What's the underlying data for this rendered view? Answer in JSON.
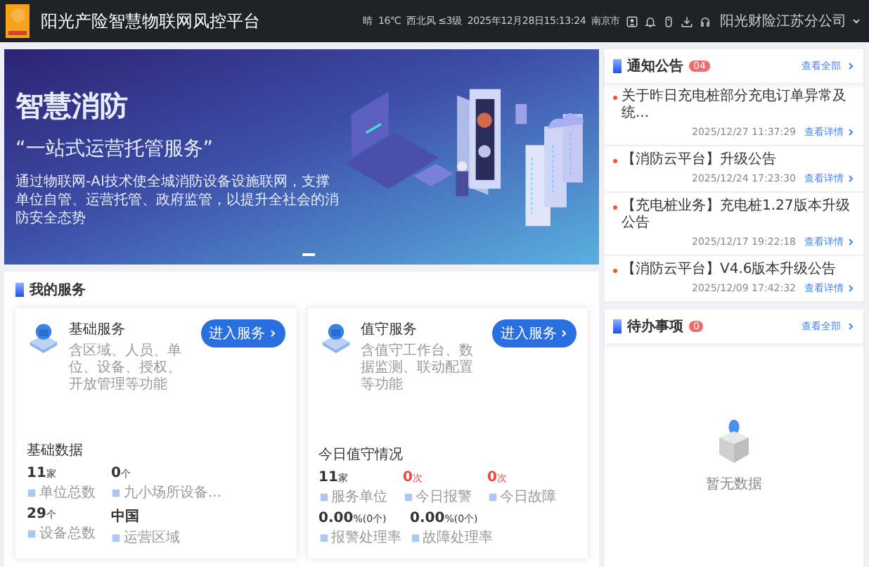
{
  "header": {
    "title": "阳光产险智慧物联网风控平台",
    "weather": "晴",
    "temperature": "16℃",
    "wind": "西北风 ≤3级",
    "datetime": "2025年12月28日15:13:24",
    "city": "南京市",
    "company": "阳光财险江苏分公司"
  },
  "banner": {
    "title": "智慧消防",
    "slogan": "“一站式运营托管服务”",
    "description": "通过物联网-AI技术使全城消防设备设施联网，支撑单位自管、运营托管、政府监管，以提升全社会的消防安全态势"
  },
  "services": {
    "title": "我的服务",
    "cards": [
      {
        "name": "基础服务",
        "description": "含区域、人员、单位、设备、授权、开放管理等功能",
        "button": "进入服务",
        "stats_title": "基础数据",
        "stats": [
          {
            "value": "11",
            "unit": "家",
            "label": "单位总数",
            "alert": false
          },
          {
            "value": "0",
            "unit": "个",
            "label": "九小场所设备...",
            "alert": false
          },
          {
            "value": "29",
            "unit": "个",
            "label": "设备总数",
            "alert": false
          },
          {
            "value": "中国",
            "label": "运营区域",
            "alert": false
          }
        ]
      },
      {
        "name": "值守服务",
        "description": "含值守工作台、数据监测、联动配置等功能",
        "button": "进入服务",
        "stats_title": "今日值守情况",
        "stats": [
          {
            "value": "11",
            "unit": "家",
            "label": "服务单位",
            "alert": false
          },
          {
            "value": "0",
            "unit": "次",
            "label": "今日报警",
            "alert": true
          },
          {
            "value": "0",
            "unit": "次",
            "label": "今日故障",
            "alert": true
          },
          {
            "value": "0.00",
            "unit": "%(0个)",
            "label": "报警处理率",
            "alert": false
          },
          {
            "value": "0.00",
            "unit": "%(0个)",
            "label": "故障处理率",
            "alert": false
          }
        ]
      }
    ]
  },
  "notices": {
    "title": "通知公告",
    "badge": "04",
    "view_all": "查看全部",
    "items": [
      {
        "title": "关于昨日充电桩部分充电订单异常及统...",
        "date": "2025/12/27 11:37:29",
        "link": "查看详情"
      },
      {
        "title": "【消防云平台】升级公告",
        "date": "2025/12/24 17:23:30",
        "link": "查看详情"
      },
      {
        "title": "【充电桩业务】充电桩1.27版本升级公告",
        "date": "2025/12/17 19:22:18",
        "link": "查看详情"
      },
      {
        "title": "【消防云平台】V4.6版本升级公告",
        "date": "2025/12/09 17:42:32",
        "link": "查看详情"
      }
    ]
  },
  "todo": {
    "title": "待办事项",
    "badge": "0",
    "view_all": "查看全部",
    "empty_text": "暂无数据"
  }
}
